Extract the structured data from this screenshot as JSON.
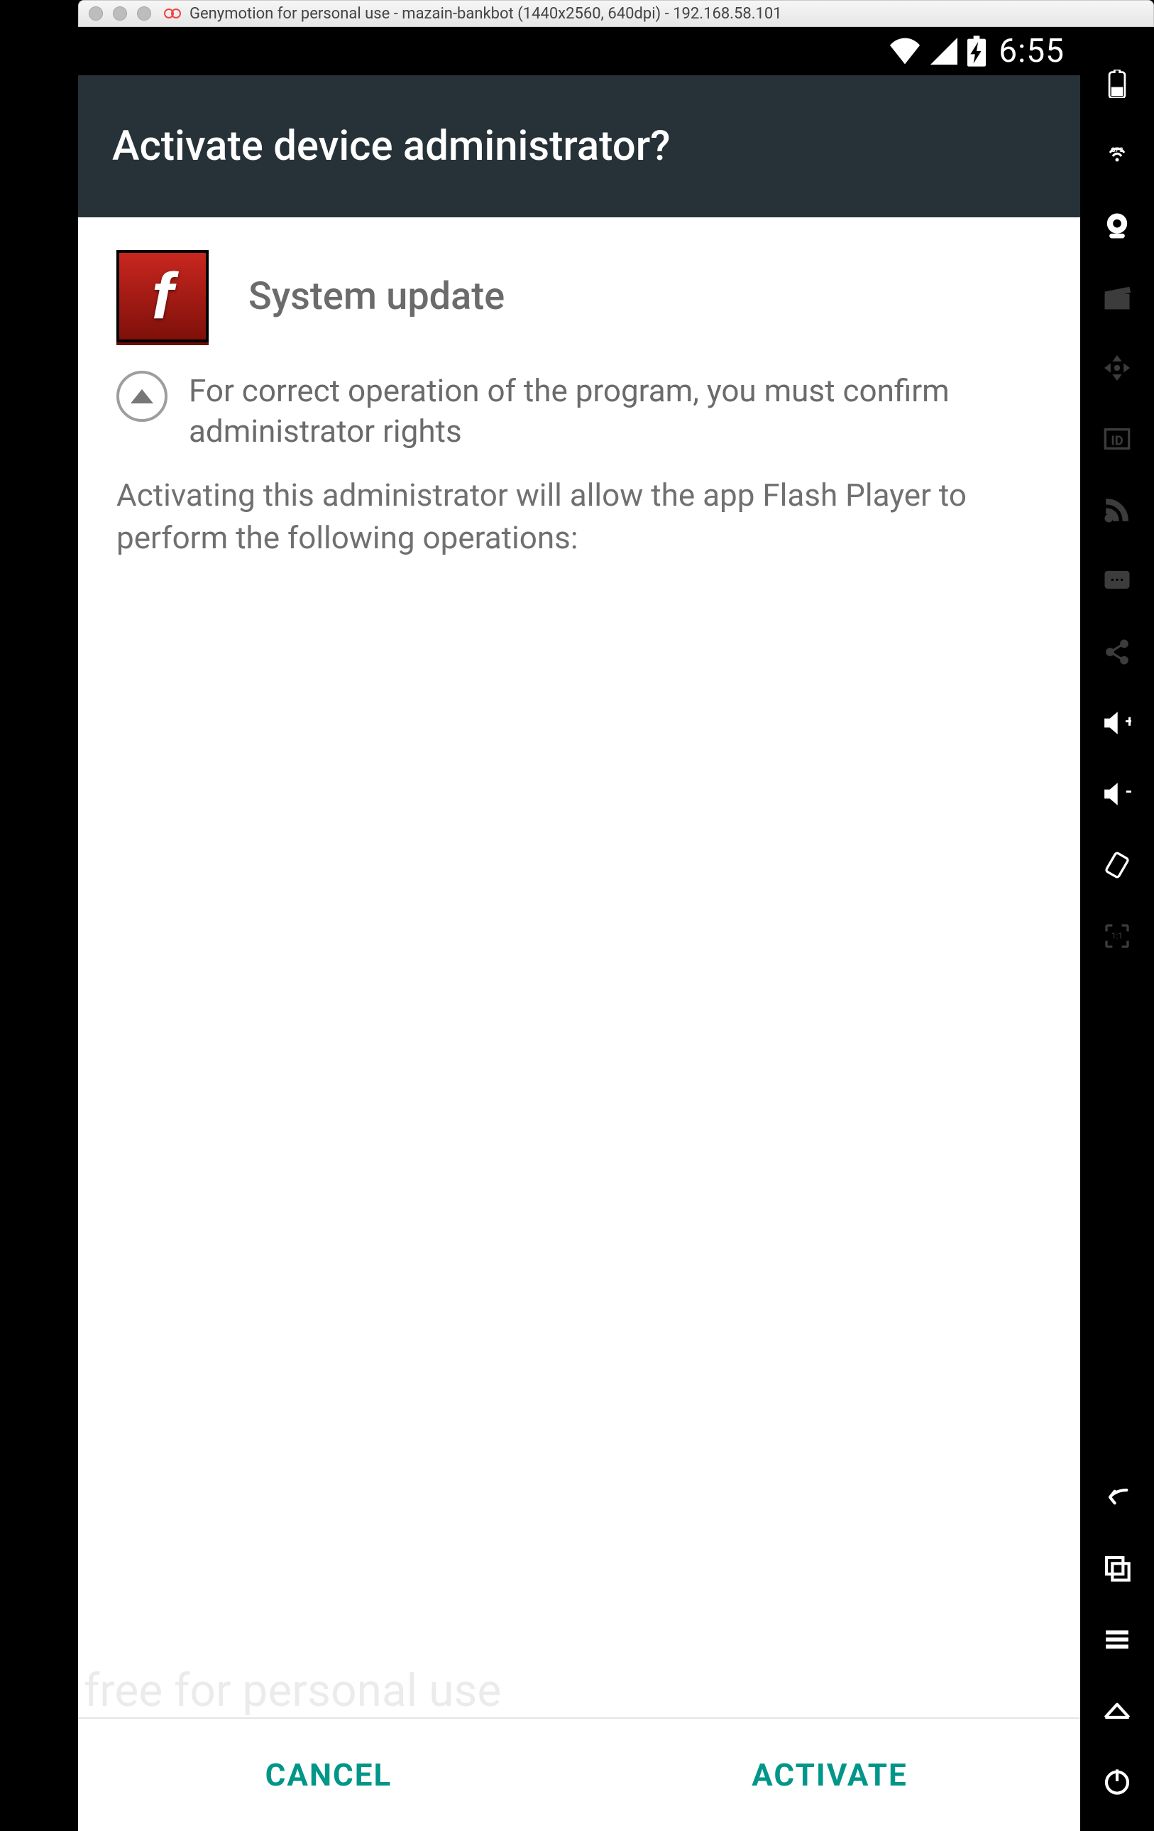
{
  "window": {
    "title": "Genymotion for personal use - mazain-bankbot (1440x2560, 640dpi) - 192.168.58.101"
  },
  "statusbar": {
    "time": "6:55"
  },
  "appbar": {
    "title": "Activate device administrator?"
  },
  "admin": {
    "app_name": "System update",
    "explain": "For correct operation of the program, you must confirm administrator rights",
    "description": "Activating this administrator will allow the app Flash Player to perform the following operations:"
  },
  "buttons": {
    "cancel": "CANCEL",
    "activate": "ACTIVATE"
  },
  "watermark": "free for personal use",
  "geny_icons": [
    "battery-icon",
    "gps-icon",
    "camera-icon",
    "clapper-icon",
    "move-icon",
    "id-icon",
    "rss-icon",
    "sms-icon",
    "share-icon",
    "volume-up-icon",
    "volume-down-icon",
    "rotate-icon",
    "fullscreen-icon"
  ],
  "geny_nav": [
    "back-icon",
    "recent-icon",
    "menu-icon",
    "home-icon",
    "power-icon"
  ]
}
